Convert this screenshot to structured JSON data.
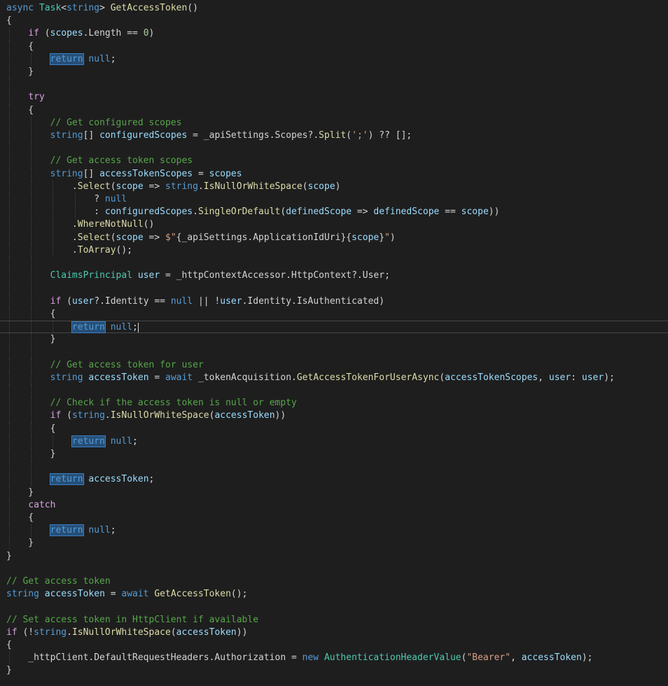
{
  "editor": {
    "language": "csharp",
    "current_line": 26,
    "colors": {
      "background": "#1e1e1e",
      "keyword": "#569cd6",
      "control": "#d8a0df",
      "type": "#4ec9b0",
      "method": "#dcdcaa",
      "variable": "#9cdcfe",
      "string": "#d69d85",
      "number": "#b5cea8",
      "comment": "#57a64a",
      "text": "#d4d4d4",
      "highlight": "#264f78"
    },
    "lines": [
      [
        {
          "t": "async",
          "c": "kw"
        },
        {
          "t": " "
        },
        {
          "t": "Task",
          "c": "type"
        },
        {
          "t": "<"
        },
        {
          "t": "string",
          "c": "kw"
        },
        {
          "t": "> "
        },
        {
          "t": "GetAccessToken",
          "c": "fn"
        },
        {
          "t": "()"
        }
      ],
      [
        {
          "t": "{"
        }
      ],
      [
        {
          "t": "    "
        },
        {
          "t": "if",
          "c": "ctl"
        },
        {
          "t": " ("
        },
        {
          "t": "scopes",
          "c": "var"
        },
        {
          "t": ".Length == "
        },
        {
          "t": "0",
          "c": "num"
        },
        {
          "t": ")"
        }
      ],
      [
        {
          "t": "    {"
        }
      ],
      [
        {
          "t": "        "
        },
        {
          "t": "return",
          "c": "hl"
        },
        {
          "t": " "
        },
        {
          "t": "null",
          "c": "kw"
        },
        {
          "t": ";"
        }
      ],
      [
        {
          "t": "    }"
        }
      ],
      [],
      [
        {
          "t": "    "
        },
        {
          "t": "try",
          "c": "ctl"
        }
      ],
      [
        {
          "t": "    {"
        }
      ],
      [
        {
          "t": "        "
        },
        {
          "t": "// Get configured scopes",
          "c": "cmt"
        }
      ],
      [
        {
          "t": "        "
        },
        {
          "t": "string",
          "c": "kw"
        },
        {
          "t": "[] "
        },
        {
          "t": "configuredScopes",
          "c": "var"
        },
        {
          "t": " = _apiSettings.Scopes?."
        },
        {
          "t": "Split",
          "c": "fn"
        },
        {
          "t": "("
        },
        {
          "t": "';'",
          "c": "str"
        },
        {
          "t": ") ?? [];"
        }
      ],
      [],
      [
        {
          "t": "        "
        },
        {
          "t": "// Get access token scopes",
          "c": "cmt"
        }
      ],
      [
        {
          "t": "        "
        },
        {
          "t": "string",
          "c": "kw"
        },
        {
          "t": "[] "
        },
        {
          "t": "accessTokenScopes",
          "c": "var"
        },
        {
          "t": " = "
        },
        {
          "t": "scopes",
          "c": "var"
        }
      ],
      [
        {
          "t": "            ."
        },
        {
          "t": "Select",
          "c": "fn"
        },
        {
          "t": "("
        },
        {
          "t": "scope",
          "c": "var"
        },
        {
          "t": " => "
        },
        {
          "t": "string",
          "c": "kw"
        },
        {
          "t": "."
        },
        {
          "t": "IsNullOrWhiteSpace",
          "c": "fn"
        },
        {
          "t": "("
        },
        {
          "t": "scope",
          "c": "var"
        },
        {
          "t": ")"
        }
      ],
      [
        {
          "t": "                ? "
        },
        {
          "t": "null",
          "c": "kw"
        }
      ],
      [
        {
          "t": "                : "
        },
        {
          "t": "configuredScopes",
          "c": "var"
        },
        {
          "t": "."
        },
        {
          "t": "SingleOrDefault",
          "c": "fn"
        },
        {
          "t": "("
        },
        {
          "t": "definedScope",
          "c": "var"
        },
        {
          "t": " => "
        },
        {
          "t": "definedScope",
          "c": "var"
        },
        {
          "t": " == "
        },
        {
          "t": "scope",
          "c": "var"
        },
        {
          "t": "))"
        }
      ],
      [
        {
          "t": "            ."
        },
        {
          "t": "WhereNotNull",
          "c": "fn"
        },
        {
          "t": "()"
        }
      ],
      [
        {
          "t": "            ."
        },
        {
          "t": "Select",
          "c": "fn"
        },
        {
          "t": "("
        },
        {
          "t": "scope",
          "c": "var"
        },
        {
          "t": " => "
        },
        {
          "t": "$\"",
          "c": "str"
        },
        {
          "t": "{_apiSettings.ApplicationIdUri}{"
        },
        {
          "t": "scope",
          "c": "var"
        },
        {
          "t": "}"
        },
        {
          "t": "\"",
          "c": "str"
        },
        {
          "t": ")"
        }
      ],
      [
        {
          "t": "            ."
        },
        {
          "t": "ToArray",
          "c": "fn"
        },
        {
          "t": "();"
        }
      ],
      [],
      [
        {
          "t": "        "
        },
        {
          "t": "ClaimsPrincipal",
          "c": "type"
        },
        {
          "t": " "
        },
        {
          "t": "user",
          "c": "var"
        },
        {
          "t": " = _httpContextAccessor.HttpContext?.User;"
        }
      ],
      [],
      [
        {
          "t": "        "
        },
        {
          "t": "if",
          "c": "ctl"
        },
        {
          "t": " ("
        },
        {
          "t": "user",
          "c": "var"
        },
        {
          "t": "?.Identity == "
        },
        {
          "t": "null",
          "c": "kw"
        },
        {
          "t": " || !"
        },
        {
          "t": "user",
          "c": "var"
        },
        {
          "t": ".Identity.IsAuthenticated)"
        }
      ],
      [
        {
          "t": "        {"
        }
      ],
      [
        {
          "t": "            "
        },
        {
          "t": "return",
          "c": "hl"
        },
        {
          "t": " "
        },
        {
          "t": "null",
          "c": "kw"
        },
        {
          "t": ";"
        },
        {
          "t": "",
          "c": "caret"
        }
      ],
      [
        {
          "t": "        }"
        }
      ],
      [],
      [
        {
          "t": "        "
        },
        {
          "t": "// Get access token for user",
          "c": "cmt"
        }
      ],
      [
        {
          "t": "        "
        },
        {
          "t": "string",
          "c": "kw"
        },
        {
          "t": " "
        },
        {
          "t": "accessToken",
          "c": "var"
        },
        {
          "t": " = "
        },
        {
          "t": "await",
          "c": "kw"
        },
        {
          "t": " _tokenAcquisition."
        },
        {
          "t": "GetAccessTokenForUserAsync",
          "c": "fn"
        },
        {
          "t": "("
        },
        {
          "t": "accessTokenScopes",
          "c": "var"
        },
        {
          "t": ", "
        },
        {
          "t": "user",
          "c": "var"
        },
        {
          "t": ": "
        },
        {
          "t": "user",
          "c": "var"
        },
        {
          "t": ");"
        }
      ],
      [],
      [
        {
          "t": "        "
        },
        {
          "t": "// Check if the access token is null or empty",
          "c": "cmt"
        }
      ],
      [
        {
          "t": "        "
        },
        {
          "t": "if",
          "c": "ctl"
        },
        {
          "t": " ("
        },
        {
          "t": "string",
          "c": "kw"
        },
        {
          "t": "."
        },
        {
          "t": "IsNullOrWhiteSpace",
          "c": "fn"
        },
        {
          "t": "("
        },
        {
          "t": "accessToken",
          "c": "var"
        },
        {
          "t": "))"
        }
      ],
      [
        {
          "t": "        {"
        }
      ],
      [
        {
          "t": "            "
        },
        {
          "t": "return",
          "c": "hl"
        },
        {
          "t": " "
        },
        {
          "t": "null",
          "c": "kw"
        },
        {
          "t": ";"
        }
      ],
      [
        {
          "t": "        }"
        }
      ],
      [],
      [
        {
          "t": "        "
        },
        {
          "t": "return",
          "c": "hl"
        },
        {
          "t": " "
        },
        {
          "t": "accessToken",
          "c": "var"
        },
        {
          "t": ";"
        }
      ],
      [
        {
          "t": "    }"
        }
      ],
      [
        {
          "t": "    "
        },
        {
          "t": "catch",
          "c": "ctl"
        }
      ],
      [
        {
          "t": "    {"
        }
      ],
      [
        {
          "t": "        "
        },
        {
          "t": "return",
          "c": "hl"
        },
        {
          "t": " "
        },
        {
          "t": "null",
          "c": "kw"
        },
        {
          "t": ";"
        }
      ],
      [
        {
          "t": "    }"
        }
      ],
      [
        {
          "t": "}"
        }
      ],
      [],
      [
        {
          "t": "// Get access token",
          "c": "cmt"
        }
      ],
      [
        {
          "t": "string",
          "c": "kw"
        },
        {
          "t": " "
        },
        {
          "t": "accessToken",
          "c": "var"
        },
        {
          "t": " = "
        },
        {
          "t": "await",
          "c": "kw"
        },
        {
          "t": " "
        },
        {
          "t": "GetAccessToken",
          "c": "fn"
        },
        {
          "t": "();"
        }
      ],
      [],
      [
        {
          "t": "// Set access token in HttpClient if available",
          "c": "cmt"
        }
      ],
      [
        {
          "t": "if",
          "c": "ctl"
        },
        {
          "t": " (!"
        },
        {
          "t": "string",
          "c": "kw"
        },
        {
          "t": "."
        },
        {
          "t": "IsNullOrWhiteSpace",
          "c": "fn"
        },
        {
          "t": "("
        },
        {
          "t": "accessToken",
          "c": "var"
        },
        {
          "t": "))"
        }
      ],
      [
        {
          "t": "{"
        }
      ],
      [
        {
          "t": "    _httpClient.DefaultRequestHeaders.Authorization = "
        },
        {
          "t": "new",
          "c": "kw"
        },
        {
          "t": " "
        },
        {
          "t": "AuthenticationHeaderValue",
          "c": "type"
        },
        {
          "t": "("
        },
        {
          "t": "\"Bearer\"",
          "c": "str"
        },
        {
          "t": ", "
        },
        {
          "t": "accessToken",
          "c": "var"
        },
        {
          "t": ");"
        }
      ],
      [
        {
          "t": "}"
        }
      ]
    ]
  }
}
